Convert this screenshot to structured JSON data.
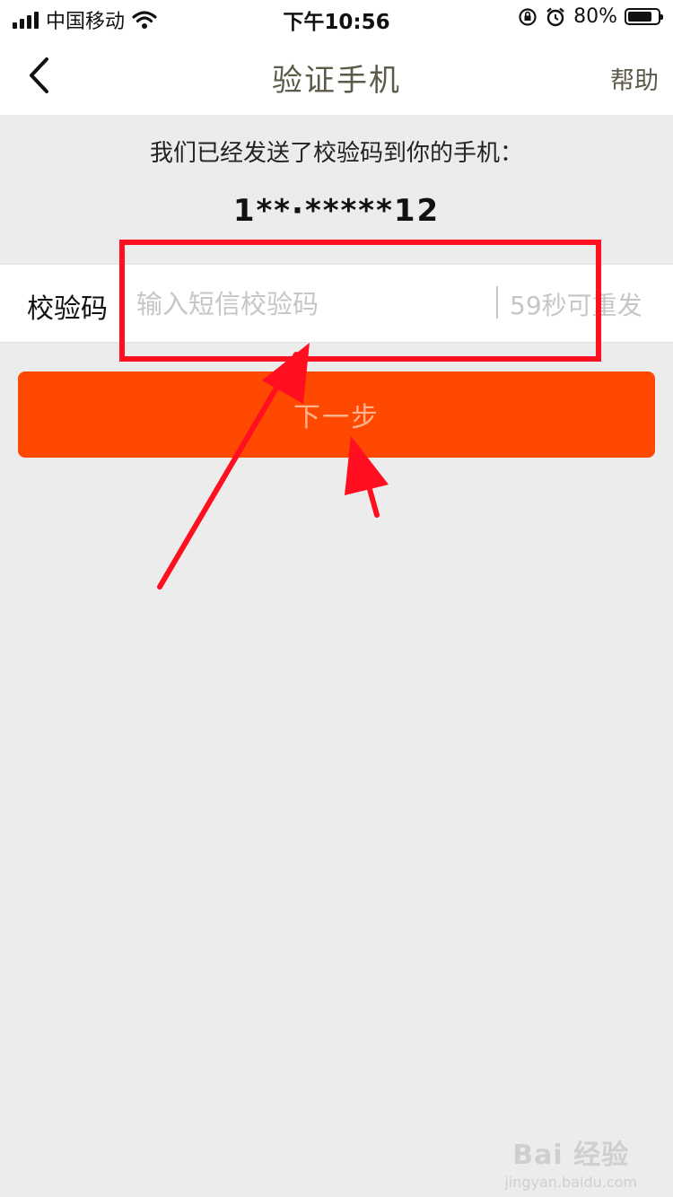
{
  "status_bar": {
    "carrier": "中国移动",
    "time": "下午10:56",
    "battery_percent": "80%",
    "battery_level": 0.8
  },
  "nav": {
    "title": "验证手机",
    "help_label": "帮助"
  },
  "verification": {
    "hint_text": "我们已经发送了校验码到你的手机：",
    "masked_phone": "1**·*****12",
    "code_label": "校验码",
    "code_placeholder": "输入短信校验码",
    "code_value": "",
    "resend_text": "59秒可重发"
  },
  "actions": {
    "next_label": "下一步"
  },
  "annotation": {
    "color": "#ff0f1f"
  },
  "watermark": {
    "brand": "Bai 经验",
    "url": "jingyan.baidu.com"
  }
}
